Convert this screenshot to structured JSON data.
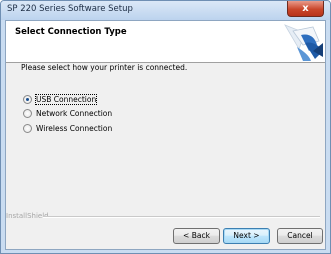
{
  "window": {
    "title": "SP 220 Series Software Setup",
    "close_glyph": "x"
  },
  "header": {
    "title": "Select Connection Type",
    "logo_icon": "printer-setup-logo"
  },
  "instruction": "Please select how your printer is connected.",
  "options": [
    {
      "label": "USB Connection",
      "selected": true
    },
    {
      "label": "Network Connection",
      "selected": false
    },
    {
      "label": "Wireless Connection",
      "selected": false
    }
  ],
  "footer": {
    "brand": "InstallShield",
    "back_label": "< Back",
    "next_label": "Next >",
    "cancel_label": "Cancel"
  },
  "colors": {
    "accent": "#1a4f8f",
    "close": "#c9472b"
  }
}
